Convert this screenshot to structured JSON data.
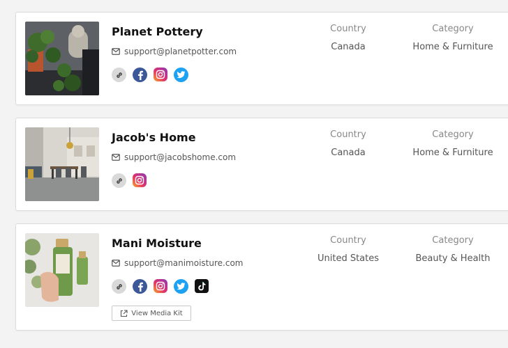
{
  "columns": {
    "country_label": "Country",
    "category_label": "Category"
  },
  "brands": [
    {
      "name": "Planet Pottery",
      "email": "support@planetpotter.com",
      "country": "Canada",
      "category": "Home & Furniture",
      "socials": [
        "link-icon",
        "facebook-icon",
        "instagram-icon",
        "twitter-icon"
      ]
    },
    {
      "name": "Jacob's Home",
      "email": "support@jacobshome.com",
      "country": "Canada",
      "category": "Home & Furniture",
      "socials": [
        "link-icon",
        "instagram-icon"
      ]
    },
    {
      "name": "Mani Moisture",
      "email": "support@manimoisture.com",
      "country": "United States",
      "category": "Beauty & Health",
      "socials": [
        "link-icon",
        "facebook-icon",
        "instagram-icon",
        "twitter-icon",
        "tiktok-icon"
      ],
      "media_kit_label": "View Media Kit"
    }
  ],
  "colors": {
    "facebook": "#3b5998",
    "twitter": "#1da1f2",
    "instagram": "#e1306c",
    "tiktok": "#111111"
  }
}
